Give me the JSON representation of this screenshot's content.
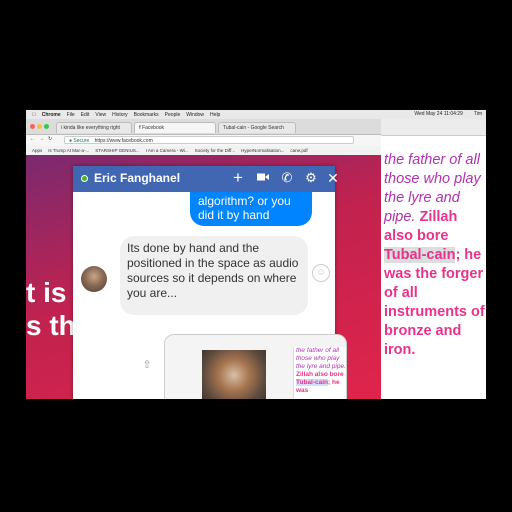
{
  "menubar": {
    "apple": "",
    "items": [
      "Chrome",
      "File",
      "Edit",
      "View",
      "History",
      "Bookmarks",
      "People",
      "Window",
      "Help"
    ],
    "clock": "Wed May 24  11:04:29",
    "user": "Tim"
  },
  "tabs": [
    {
      "label": "i kinda like everything right"
    },
    {
      "label": "Facebook"
    },
    {
      "label": "Tubal-cain - Google Search"
    }
  ],
  "address": {
    "secure_label": "Secure",
    "url": "https://www.facebook.com"
  },
  "bookmarks": [
    "Apps",
    "Is Trump At Mar-a-...",
    "STARSHIP GENIUS...",
    "I Am a Camera - Wi...",
    "Society for the Diff...",
    "HyperNormalisation...",
    "cane.pdf"
  ],
  "background_text": {
    "line1": "t is",
    "line2": "s th"
  },
  "chat": {
    "name": "Eric Fanghanel",
    "sent_message": "algorithm? or you did it by hand",
    "received_message": "Its done by hand and the positioned in the space as audio sources so it depends on where you are...",
    "icons": [
      "add-icon",
      "video-icon",
      "phone-icon",
      "gear-icon",
      "close-icon"
    ]
  },
  "book": {
    "part1": "the father of all those who play the lyre and pipe. ",
    "part2": "Zillah also bore ",
    "part3": "Tubal-cain",
    "part4": "; he was the forger of all instruments of bronze and iron."
  },
  "attachment": {
    "mini_part1": "the father of all those who play the lyre and pipe. ",
    "mini_part2": "Zillah also bore ",
    "mini_part3": "Tubal-cain",
    "mini_part4": "; he was"
  },
  "colors": {
    "messenger_blue": "#4267b2",
    "sent_bubble": "#0084ff",
    "book_purple": "#b032b0",
    "book_pink": "#e8338a"
  }
}
